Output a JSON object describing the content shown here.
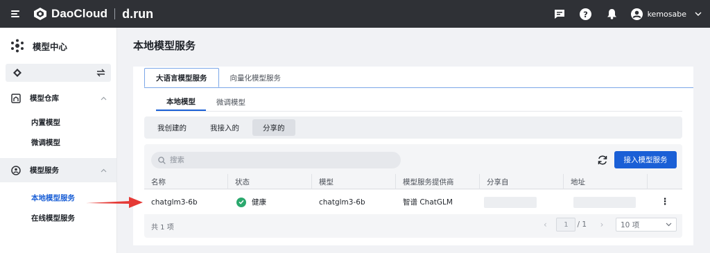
{
  "topbar": {
    "brand": "DaoCloud",
    "product": "d.run",
    "username": "kemosabe",
    "icons": [
      "menu-icon",
      "message-icon",
      "help-icon",
      "bell-icon",
      "user-avatar-icon",
      "chevron-down-icon"
    ]
  },
  "sidebar": {
    "title": "模型中心",
    "workspace": "",
    "groups": [
      {
        "label": "模型仓库",
        "icon": "warehouse-icon",
        "items": [
          "内置模型",
          "微调模型"
        ]
      },
      {
        "label": "模型服务",
        "icon": "service-icon",
        "items": [
          "本地模型服务",
          "在线模型服务"
        ],
        "active_item": "本地模型服务"
      }
    ]
  },
  "main": {
    "title": "本地模型服务",
    "tabs": [
      {
        "label": "大语言模型服务",
        "active": true
      },
      {
        "label": "向量化模型服务",
        "active": false
      }
    ],
    "subtabs": [
      {
        "label": "本地模型",
        "active": true
      },
      {
        "label": "微调模型",
        "active": false
      }
    ],
    "filters": [
      {
        "label": "我创建的",
        "active": false
      },
      {
        "label": "我接入的",
        "active": false
      },
      {
        "label": "分享的",
        "active": true
      }
    ],
    "search": {
      "placeholder": "搜索",
      "value": ""
    },
    "primary_button": "接入模型服务",
    "table": {
      "columns": [
        "名称",
        "状态",
        "模型",
        "模型服务提供商",
        "分享自",
        "地址",
        ""
      ],
      "rows": [
        {
          "name": "chatglm3-6b",
          "status": "健康",
          "model": "chatglm3-6b",
          "provider": "智谱 ChatGLM",
          "shared_from": "",
          "address": ""
        }
      ]
    },
    "footer": {
      "total": "共 1 项",
      "page": "1",
      "pages": "/ 1",
      "page_size": "10 项"
    }
  },
  "colors": {
    "accent": "#1a5fd6",
    "healthy": "#2aa86d",
    "arrow": "#e53935",
    "topbar": "#2f3136"
  }
}
